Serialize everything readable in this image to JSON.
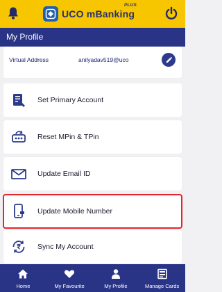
{
  "app": {
    "brand": "UCO mBanking",
    "brand_suffix": "PLUS"
  },
  "header": {
    "title": "My Profile"
  },
  "profile": {
    "virtual_address_label": "Virtual Address",
    "virtual_address_value": "anilyadav519@uco"
  },
  "menu": [
    {
      "label": "Set Primary Account",
      "icon": "account-list-icon"
    },
    {
      "label": "Reset MPin & TPin",
      "icon": "pin-reset-icon"
    },
    {
      "label": "Update Email ID",
      "icon": "email-icon"
    },
    {
      "label": "Update Mobile Number",
      "icon": "mobile-update-icon",
      "highlighted": true
    },
    {
      "label": "Sync My Account",
      "icon": "sync-rupee-icon"
    }
  ],
  "bottom_nav": [
    {
      "label": "Home",
      "icon": "home-icon"
    },
    {
      "label": "My Favourite",
      "icon": "heart-icon"
    },
    {
      "label": "My Profile",
      "icon": "person-icon"
    },
    {
      "label": "Manage Cards",
      "icon": "cards-icon"
    }
  ],
  "colors": {
    "topbar": "#f7c600",
    "primary": "#2a3486",
    "highlight": "#e4252b"
  }
}
